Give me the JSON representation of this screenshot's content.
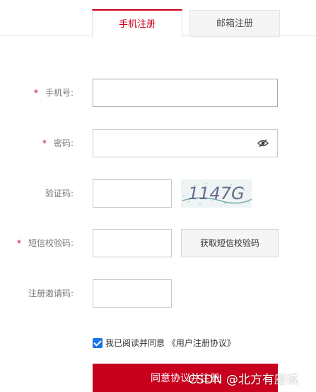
{
  "tabs": [
    {
      "label": "手机注册",
      "active": true
    },
    {
      "label": "邮箱注册",
      "active": false
    }
  ],
  "form": {
    "phone": {
      "label": "手机号:",
      "required": true,
      "value": ""
    },
    "password": {
      "label": "密码:",
      "required": true,
      "value": ""
    },
    "captcha": {
      "label": "验证码:",
      "required": false,
      "value": "",
      "image_text": "1147G"
    },
    "sms": {
      "label": "短信校验码:",
      "required": true,
      "value": "",
      "button_label": "获取短信校验码"
    },
    "invite": {
      "label": "注册邀请码:",
      "required": false,
      "value": ""
    }
  },
  "required_mark": "*",
  "agreement": {
    "checked": true,
    "text": "我已阅读并同意 《用户注册协议》"
  },
  "submit_label": "同意协议并注册",
  "watermark": "CSDN @北方有座城",
  "colors": {
    "accent": "#c8001e",
    "checkbox": "#1a73e8"
  }
}
